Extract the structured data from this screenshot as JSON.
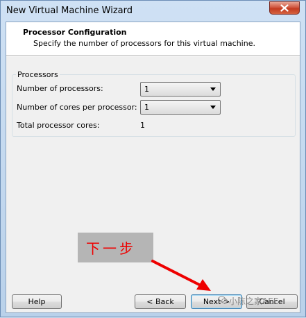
{
  "window": {
    "title": "New Virtual Machine Wizard",
    "close_icon": "close-x-icon",
    "accent_color": "#c33b20"
  },
  "header": {
    "title": "Processor Configuration",
    "subtitle": "Specify the number of processors for this virtual machine."
  },
  "processors": {
    "group_label": "Processors",
    "num_processors_label": "Number of processors:",
    "num_processors_value": "1",
    "cores_per_processor_label": "Number of cores per processor:",
    "cores_per_processor_value": "1",
    "total_cores_label": "Total processor cores:",
    "total_cores_value": "1"
  },
  "buttons": {
    "help": "Help",
    "back": "< Back",
    "next": "Next >",
    "cancel": "Cancel"
  },
  "annotation": {
    "callout_text": "下一步",
    "callout_color": "#ee0000",
    "watermark": "小陈之家AEE"
  }
}
